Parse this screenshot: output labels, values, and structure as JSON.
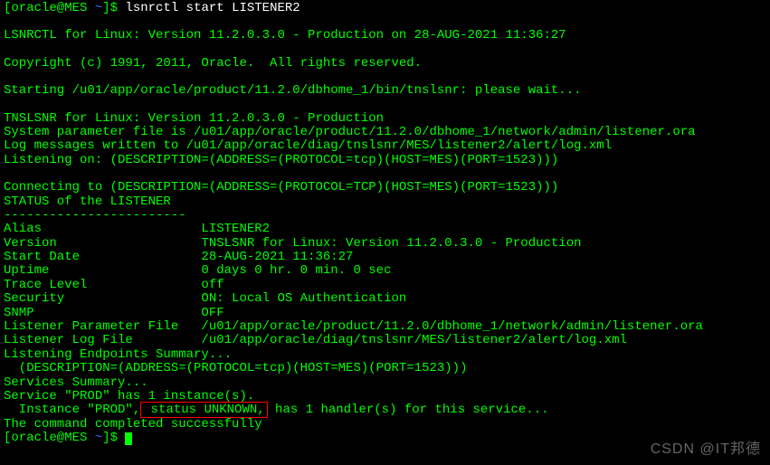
{
  "prompt1": {
    "userhost": "[oracle@MES ",
    "tilde": "~",
    "end": "]$ ",
    "command": "lsnrctl start LISTENER2"
  },
  "header": "LSNRCTL for Linux: Version 11.2.0.3.0 - Production on 28-AUG-2021 11:36:27",
  "copyright": "Copyright (c) 1991, 2011, Oracle.  All rights reserved.",
  "starting": "Starting /u01/app/oracle/product/11.2.0/dbhome_1/bin/tnslsnr: please wait...",
  "tnslsnr_ver": "TNSLSNR for Linux: Version 11.2.0.3.0 - Production",
  "param_file": "System parameter file is /u01/app/oracle/product/11.2.0/dbhome_1/network/admin/listener.ora",
  "log_msg": "Log messages written to /u01/app/oracle/diag/tnslsnr/MES/listener2/alert/log.xml",
  "listening_on": "Listening on: (DESCRIPTION=(ADDRESS=(PROTOCOL=tcp)(HOST=MES)(PORT=1523)))",
  "connecting": "Connecting to (DESCRIPTION=(ADDRESS=(PROTOCOL=TCP)(HOST=MES)(PORT=1523)))",
  "status_hdr": "STATUS of the LISTENER",
  "dashes": "------------------------",
  "alias": "Alias                     LISTENER2",
  "version": "Version                   TNSLSNR for Linux: Version 11.2.0.3.0 - Production",
  "start_date": "Start Date                28-AUG-2021 11:36:27",
  "uptime": "Uptime                    0 days 0 hr. 0 min. 0 sec",
  "trace": "Trace Level               off",
  "security": "Security                  ON: Local OS Authentication",
  "snmp": "SNMP                      OFF",
  "lparam": "Listener Parameter File   /u01/app/oracle/product/11.2.0/dbhome_1/network/admin/listener.ora",
  "llog": "Listener Log File         /u01/app/oracle/diag/tnslsnr/MES/listener2/alert/log.xml",
  "endpoints_hdr": "Listening Endpoints Summary...",
  "endpoint1": "  (DESCRIPTION=(ADDRESS=(PROTOCOL=tcp)(HOST=MES)(PORT=1523)))",
  "services_hdr": "Services Summary...",
  "service_line": "Service \"PROD\" has 1 instance(s).",
  "instance_pre": "  Instance \"PROD\",",
  "instance_status": " status UNKNOWN,",
  "instance_post": " has 1 handler(s) for this service...",
  "completed": "The command completed successfully",
  "prompt2": {
    "userhost": "[oracle@MES ",
    "tilde": "~",
    "end": "]$ "
  },
  "watermark": "CSDN @IT邦德"
}
